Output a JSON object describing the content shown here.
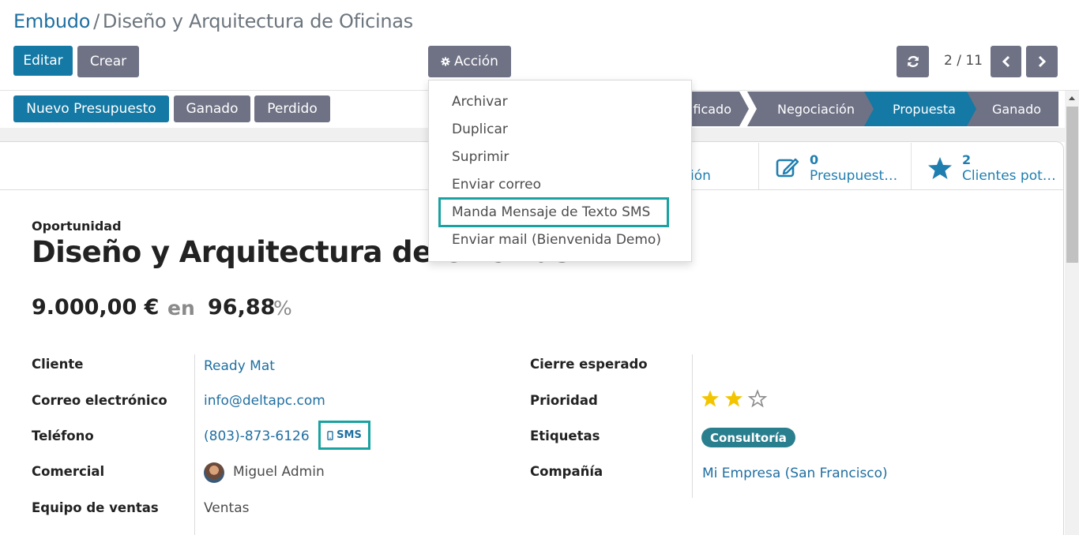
{
  "breadcrumb": {
    "parent": "Embudo",
    "separator": "/",
    "current": "Diseño y Arquitectura de Oficinas"
  },
  "toolbar": {
    "edit_label": "Editar",
    "create_label": "Crear",
    "action_label": "Acción"
  },
  "pager": {
    "value": "2 / 11"
  },
  "action_menu": {
    "items": [
      "Archivar",
      "Duplicar",
      "Suprimir",
      "Enviar correo",
      "Manda Mensaje de Texto SMS",
      "Enviar mail (Bienvenida Demo)"
    ],
    "highlighted": "Manda Mensaje de Texto SMS"
  },
  "status_buttons": {
    "new_quote": "Nuevo Presupuesto",
    "won": "Ganado",
    "lost": "Perdido"
  },
  "stages": {
    "items": [
      "ificado",
      "Negociación",
      "Propuesta",
      "Ganado"
    ],
    "active": "Propuesta"
  },
  "smart_buttons": {
    "reunion": {
      "label": "ión"
    },
    "quotations": {
      "count": "0",
      "label": "Presupuest…"
    },
    "prospects": {
      "count": "2",
      "label": "Clientes pot…"
    }
  },
  "record": {
    "type_label": "Oportunidad",
    "name": "Diseño y Arquitectura de Oficinas",
    "expected_revenue": "9.000,00 €",
    "at_label": "en",
    "probability": "96,88",
    "percent_sign": "%"
  },
  "fields": {
    "customer": {
      "label": "Cliente",
      "value": "Ready Mat"
    },
    "email": {
      "label": "Correo electrónico",
      "value": "info@deltapc.com"
    },
    "phone": {
      "label": "Teléfono",
      "value": "(803)-873-6126",
      "sms_label": "SMS"
    },
    "salesperson": {
      "label": "Comercial",
      "value": "Miguel Admin"
    },
    "sales_team": {
      "label": "Equipo de ventas",
      "value": "Ventas"
    },
    "expected_closing": {
      "label": "Cierre esperado",
      "value": ""
    },
    "priority": {
      "label": "Prioridad",
      "stars_filled": 2,
      "stars_total": 3
    },
    "tags": {
      "label": "Etiquetas",
      "value": "Consultoría"
    },
    "company": {
      "label": "Compañía",
      "value": "Mi Empresa (San Francisco)"
    }
  },
  "colors": {
    "primary": "#1479a4",
    "secondary": "#6f7285",
    "link": "#1f6fa1",
    "highlight": "#1aa2a2",
    "star": "#f3c500",
    "tag": "#2a7f8e"
  }
}
